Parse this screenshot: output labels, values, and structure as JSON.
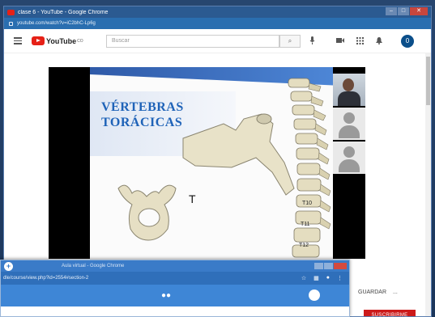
{
  "window": {
    "title": "clase 6 - YouTube - Google Chrome",
    "url": "youtube.com/watch?v=iC2bhC-Lp6g",
    "min": "–",
    "max": "□",
    "close": "✕"
  },
  "youtube": {
    "logo_text": "YouTube",
    "logo_region": "CO",
    "search_placeholder": "Buscar",
    "search_icon": "⌕",
    "mic_icon": "🎤",
    "avatar_letter": "0"
  },
  "slide": {
    "title_line1": "VÉRTEBRAS",
    "title_line2": "TORÁCICAS",
    "annot_t": "T",
    "label_t10": "T10",
    "label_t11": "T11",
    "label_t12": "T12"
  },
  "video_actions": {
    "save": "GUARDAR",
    "more": "...",
    "subscribe": "SUSCRIBIRME"
  },
  "inner_window": {
    "title": "Aula virtual - Google Chrome",
    "url": "dle/course/view.php?id=2554#section-2",
    "star": "☆"
  }
}
